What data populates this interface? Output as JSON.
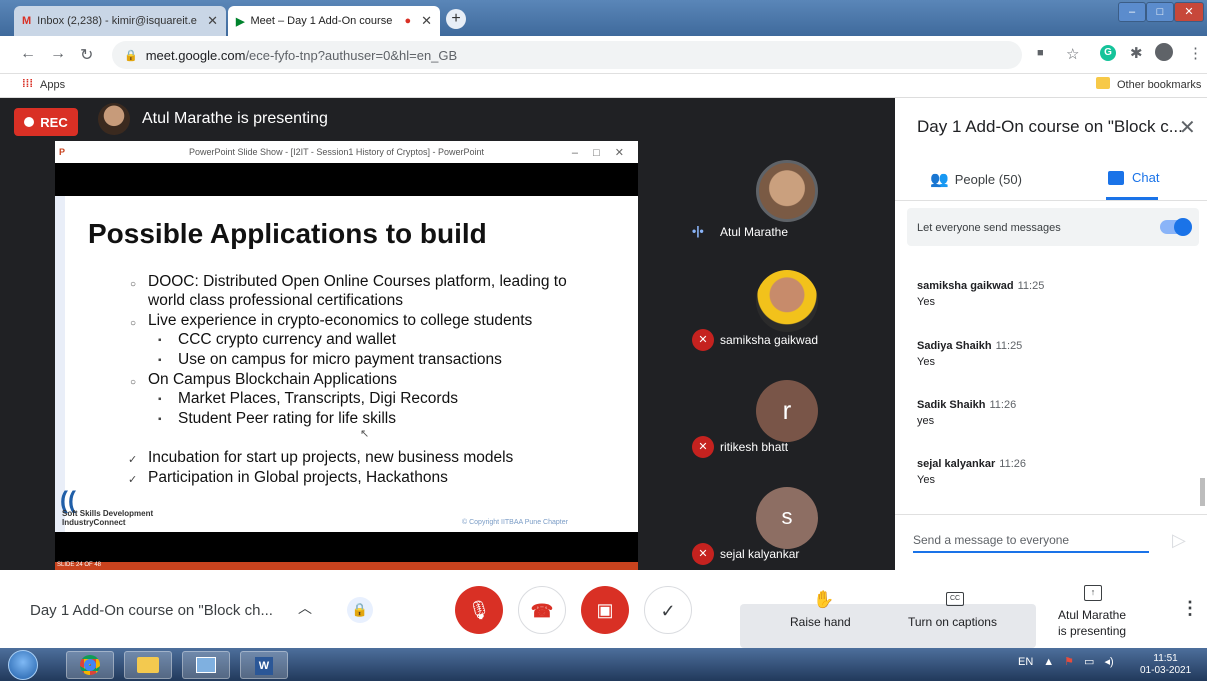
{
  "browser": {
    "tabs": [
      {
        "icon": "gmail-icon",
        "label": "Inbox (2,238) - kimir@isquareit.e"
      },
      {
        "icon": "meet-icon",
        "label": "Meet – Day 1 Add-On course"
      }
    ],
    "url_host": "meet.google.com",
    "url_path": "/ece-fyfo-tnp?authuser=0&hl=en_GB",
    "bookmarks": {
      "apps": "Apps",
      "other": "Other bookmarks"
    }
  },
  "stage": {
    "rec_label": "REC",
    "presenting_title": "Atul Marathe is presenting"
  },
  "slide": {
    "window_title": "PowerPoint Slide Show - [I2IT - Session1 History of Cryptos] - PowerPoint",
    "title": "Possible Applications to build",
    "lines": [
      "DOOC: Distributed Open Online Courses platform,  leading to",
      "world class professional certifications",
      "Live experience in crypto-economics to college students",
      "CCC crypto currency and wallet",
      "Use on campus for micro payment transactions",
      "On Campus Blockchain Applications",
      "Market Places, Transcripts, Digi Records",
      "Student Peer rating for life skills",
      "Incubation for start up projects, new business models",
      "Participation in Global projects, Hackathons"
    ],
    "org_line1": "Soft Skills Development",
    "org_line2": "IndustryConnect",
    "copyright": "© Copyright IITBAA Pune Chapter",
    "footer": "SLIDE 24 OF 48"
  },
  "participants": [
    {
      "name": "Atul Marathe",
      "initial": "",
      "muted": false
    },
    {
      "name": "samiksha gaikwad",
      "initial": "",
      "muted": true
    },
    {
      "name": "ritikesh bhatt",
      "initial": "r",
      "muted": true
    },
    {
      "name": "sejal kalyankar",
      "initial": "s",
      "muted": true
    }
  ],
  "panel": {
    "title": "Day 1 Add-On course on \"Block c...",
    "people_tab": "People (50)",
    "chat_tab": "Chat",
    "let_everyone": "Let everyone send messages",
    "messages": [
      {
        "sender": "samiksha gaikwad",
        "time": "11:25",
        "text": "Yes"
      },
      {
        "sender": "Sadiya Shaikh",
        "time": "11:25",
        "text": "Yes"
      },
      {
        "sender": "Sadik Shaikh",
        "time": "11:26",
        "text": "yes"
      },
      {
        "sender": "sejal kalyankar",
        "time": "11:26",
        "text": "Yes"
      }
    ],
    "input_placeholder": "Send a message to everyone"
  },
  "bottom": {
    "meeting_title": "Day 1 Add-On course on \"Block ch...",
    "raise_hand": "Raise hand",
    "captions": "Turn on captions",
    "presenting_line1": "Atul Marathe",
    "presenting_line2": "is presenting"
  },
  "taskbar": {
    "lang": "EN",
    "time": "11:51",
    "date": "01-03-2021"
  }
}
